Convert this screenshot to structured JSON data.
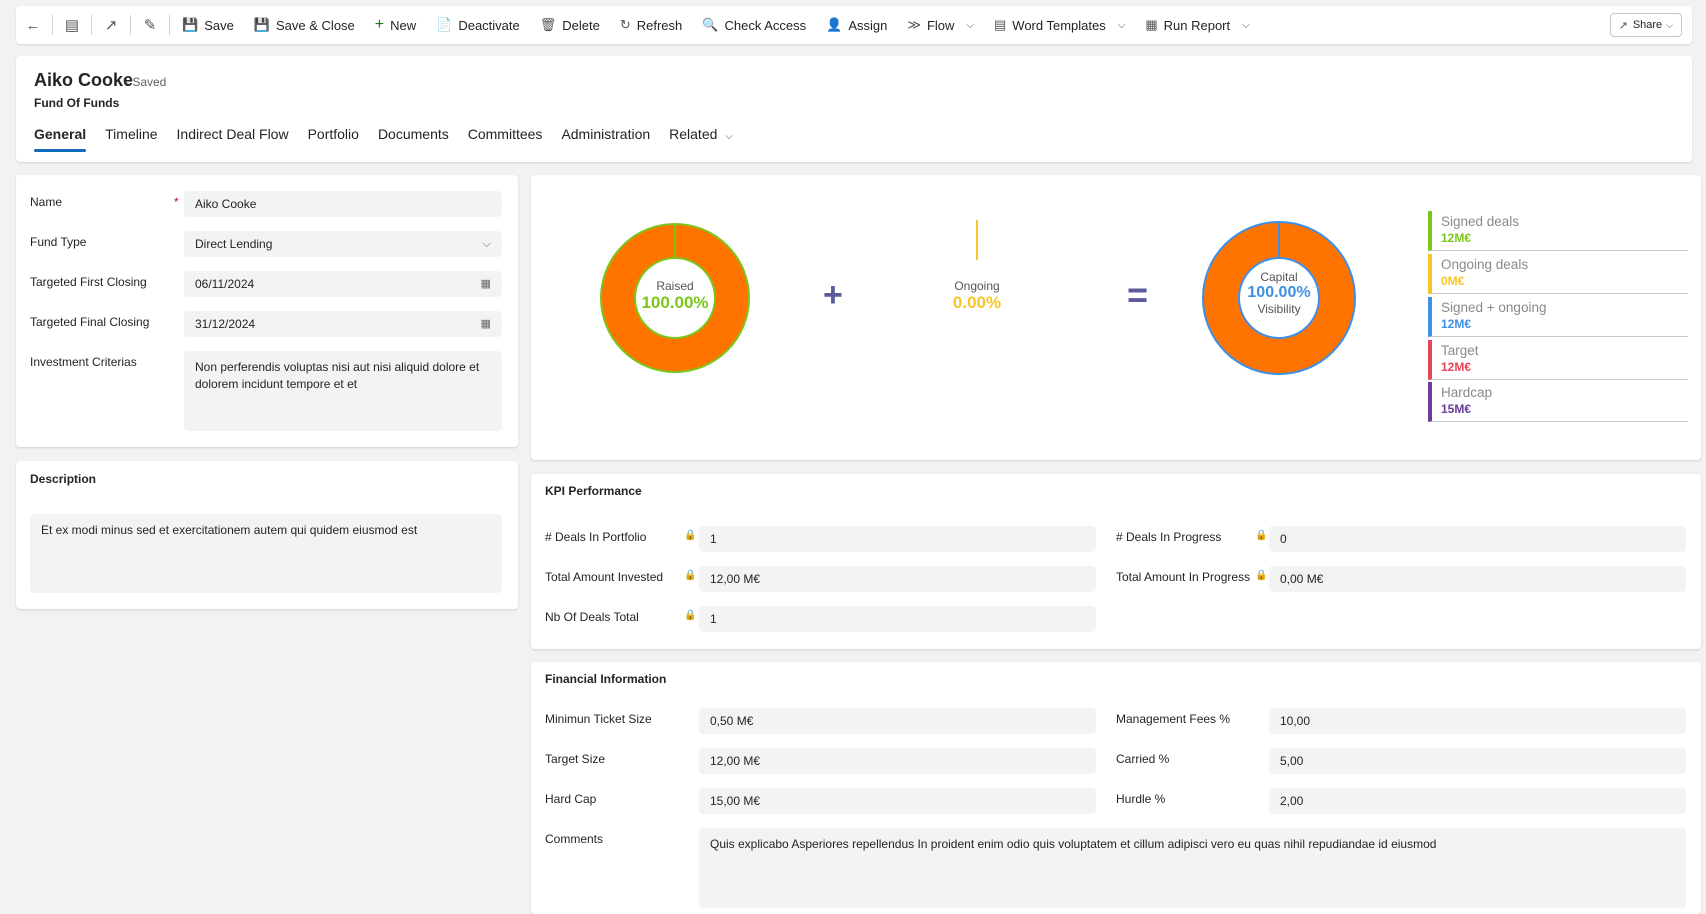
{
  "toolbar": {
    "save": "Save",
    "save_close": "Save & Close",
    "new": "New",
    "deactivate": "Deactivate",
    "delete": "Delete",
    "refresh": "Refresh",
    "check_access": "Check Access",
    "assign": "Assign",
    "flow": "Flow",
    "word_templates": "Word Templates",
    "run_report": "Run Report",
    "share": "Share"
  },
  "header": {
    "title": "Aiko Cooke",
    "status": "- Saved",
    "subtitle": "Fund Of Funds",
    "tabs": [
      "General",
      "Timeline",
      "Indirect Deal Flow",
      "Portfolio",
      "Documents",
      "Committees",
      "Administration",
      "Related"
    ]
  },
  "general": {
    "name_label": "Name",
    "name_required": "*",
    "name_value": "Aiko Cooke",
    "fund_type_label": "Fund Type",
    "fund_type_value": "Direct Lending",
    "first_closing_label": "Targeted First Closing",
    "first_closing_value": "06/11/2024",
    "final_closing_label": "Targeted Final Closing",
    "final_closing_value": "31/12/2024",
    "criteria_label": "Investment Criterias",
    "criteria_value": "Non perferendis voluptas nisi aut nisi aliquid dolore et dolorem incidunt tempore et et"
  },
  "description": {
    "title": "Description",
    "value": "Et ex modi minus sed et exercitationem autem qui quidem eiusmod est"
  },
  "visual": {
    "raised_label": "Raised",
    "raised_value": "100.00%",
    "plus": "+",
    "ongoing_label": "Ongoing",
    "ongoing_value": "0.00%",
    "equals": "=",
    "capital_label": "Capital",
    "capital_value": "100.00%",
    "visibility_label": "Visibility",
    "raised_fraction": 1.0,
    "ongoing_fraction": 0.0,
    "capital_fraction": 1.0,
    "colors": {
      "orange": "#ff7300",
      "green": "#7cc619",
      "yellow": "#f6c624",
      "blue": "#3f8fe6",
      "red": "#e8445a",
      "purple": "#6a3d9a"
    },
    "legend": [
      {
        "label": "Signed deals",
        "value": "12M€",
        "color": "#7cc619"
      },
      {
        "label": "Ongoing deals",
        "value": "0M€",
        "color": "#f6c624"
      },
      {
        "label": "Signed + ongoing",
        "value": "12M€",
        "color": "#3f8fe6"
      },
      {
        "label": "Target",
        "value": "12M€",
        "color": "#e8445a"
      },
      {
        "label": "Hardcap",
        "value": "15M€",
        "color": "#6a3d9a"
      }
    ]
  },
  "kpi": {
    "title": "KPI Performance",
    "deals_portfolio_label": "# Deals In Portfolio",
    "deals_portfolio_value": "1",
    "deals_progress_label": "# Deals In Progress",
    "deals_progress_value": "0",
    "total_invested_label": "Total Amount Invested",
    "total_invested_value": "12,00 M€",
    "total_progress_label": "Total Amount In Progress",
    "total_progress_value": "0,00 M€",
    "nb_deals_label": "Nb Of Deals Total",
    "nb_deals_value": "1"
  },
  "financial": {
    "title": "Financial Information",
    "min_ticket_label": "Minimun Ticket Size",
    "min_ticket_value": "0,50 M€",
    "mgmt_fees_label": "Management Fees %",
    "mgmt_fees_value": "10,00",
    "target_size_label": "Target Size",
    "target_size_value": "12,00 M€",
    "carried_label": "Carried %",
    "carried_value": "5,00",
    "hard_cap_label": "Hard Cap",
    "hard_cap_value": "15,00 M€",
    "hurdle_label": "Hurdle %",
    "hurdle_value": "2,00",
    "comments_label": "Comments",
    "comments_value": "Quis explicabo Asperiores repellendus In proident enim odio quis voluptatem et cillum adipisci vero eu quas nihil repudiandae id eiusmod"
  }
}
